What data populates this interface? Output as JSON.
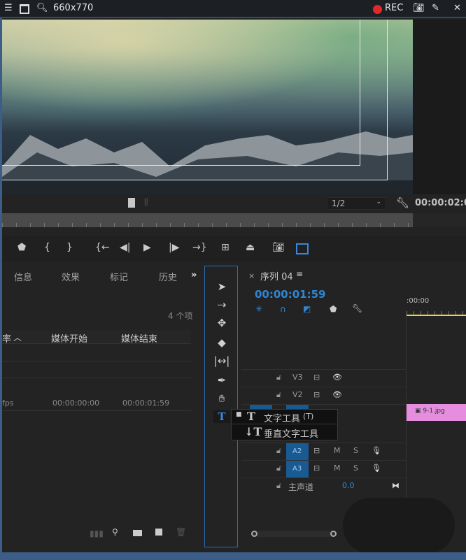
{
  "titlebar": {
    "size": "660x770",
    "rec": "REC",
    "rec_color": "#e02a2a",
    "icons": [
      "menu-icon",
      "window-icon",
      "search-icon",
      "record-icon",
      "camera-icon",
      "pencil-icon",
      "close-icon"
    ]
  },
  "monitor": {
    "zoom": "1/2",
    "timecode": "00:00:02:0"
  },
  "left_panel": {
    "tabs": [
      "信息",
      "效果",
      "标记",
      "历史"
    ],
    "more": "»",
    "count": "4 个项",
    "columns": [
      "率",
      "媒体开始",
      "媒体结束"
    ],
    "row": {
      "rate": "fps",
      "start": "00:00:00:00",
      "end": "00:00:01:59"
    }
  },
  "timeline": {
    "title": "序列 04",
    "close": "×",
    "menu": "≡",
    "timecode": "00:00:01:59",
    "ruler_start": ":00:00",
    "tracks": {
      "v3": "V3",
      "v2": "V2",
      "a2": "A2",
      "a3": "A3",
      "m": "M",
      "s": "S"
    },
    "master": "主声道",
    "master_value": "0.0",
    "clip": "9-1.jpg",
    "clip_color": "#e58ee0",
    "accent": "#2f86d6"
  },
  "context_menu": {
    "items": [
      {
        "label": "文字工具",
        "shortcut": "(T)"
      },
      {
        "label": "垂直文字工具"
      }
    ]
  }
}
